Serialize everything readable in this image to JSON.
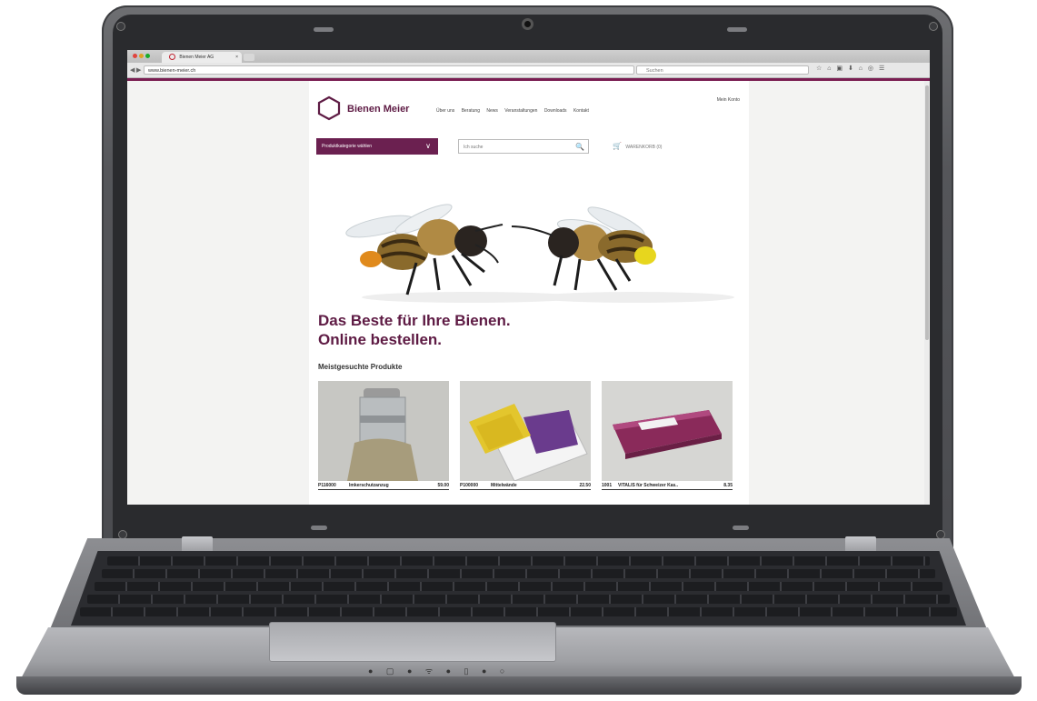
{
  "browser": {
    "tab_title": "Bienen Meier AG",
    "tab_close": "×",
    "url": "www.bienen-meier.ch",
    "search_placeholder": "Suchen",
    "nav_back": "◀",
    "nav_forward": "▶",
    "toolbar_icons": "☆ ⌂ ▣ ⬇ ⌂ ◎ ☰"
  },
  "site": {
    "logo_text": "Bienen Meier",
    "nav": [
      "Über uns",
      "Beratung",
      "News",
      "Veranstaltungen",
      "Downloads",
      "Kontakt"
    ],
    "account_link": "Mein Konto",
    "category_select": "Produktkategorie wählen",
    "category_chevron": "∨",
    "search_placeholder": "Ich suche",
    "search_icon": "🔍",
    "cart_icon": "🛒",
    "cart_text": "WARENKORB (0)"
  },
  "hero": {
    "headline_line1": "Das Beste für Ihre Bienen.",
    "headline_line2": "Online bestellen."
  },
  "products": {
    "section_title": "Meistgesuchte Produkte",
    "items": [
      {
        "code": "P116000",
        "name": "Imkerschutzanzug",
        "price": "59.00"
      },
      {
        "code": "P100000",
        "name": "Mittelwände",
        "price": "22.50"
      },
      {
        "code": "1001",
        "name": "VITALIS für Schweizer Kas..",
        "price": "8.35"
      }
    ]
  },
  "colors": {
    "brand": "#5e1b44",
    "brand_button": "#6b2050",
    "accent_line": "#7a1e52"
  },
  "laptop": {
    "status_leds": "● ▢ ● ᯤ ● ▯ ● ○"
  }
}
